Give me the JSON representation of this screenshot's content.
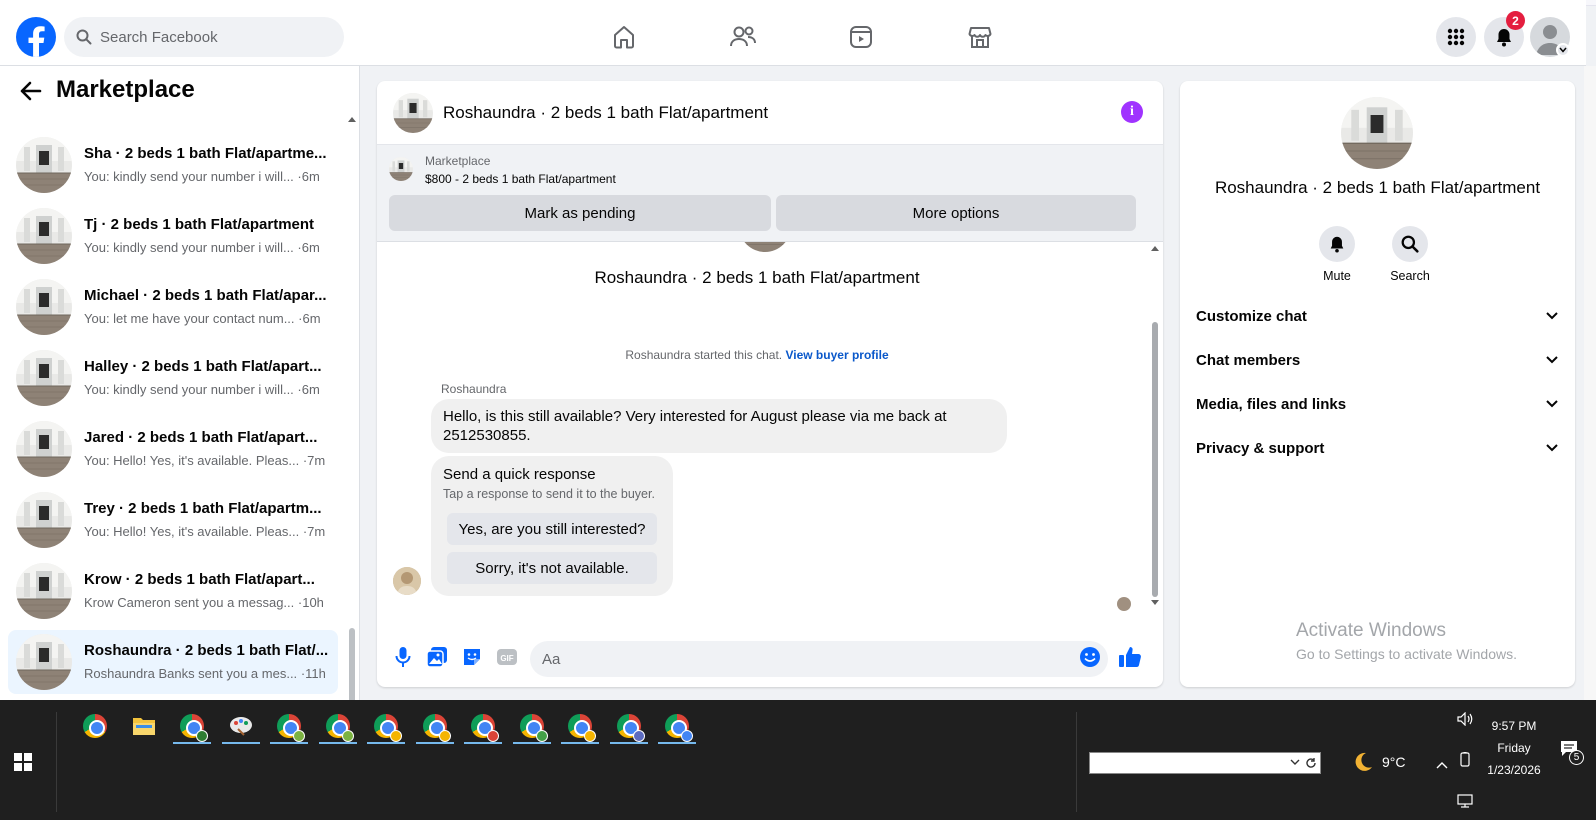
{
  "colors": {
    "fb_blue": "#0866ff",
    "badge_red": "#e41e3f",
    "info_purple": "#a033ff",
    "active_row": "#ebf5ff",
    "link_blue": "#0a58ca"
  },
  "topbar": {
    "search_placeholder": "Search Facebook",
    "notifications_count": "2",
    "nav_icons": [
      "home-icon",
      "friends-icon",
      "video-icon",
      "marketplace-icon"
    ],
    "right_icons": [
      "menu-grid-icon",
      "bell-icon",
      "profile-avatar"
    ]
  },
  "sidebar": {
    "title": "Marketplace",
    "conversations": [
      {
        "name": "Sha · 2 beds 1 bath Flat/apartme...",
        "preview": "You: kindly send your number i will...",
        "time": "·6m"
      },
      {
        "name": "Tj · 2 beds 1 bath Flat/apartment",
        "preview": "You: kindly send your number i will...",
        "time": "·6m"
      },
      {
        "name": "Michael · 2 beds 1 bath Flat/apar...",
        "preview": "You: let me have your contact num...",
        "time": "·6m"
      },
      {
        "name": "Halley · 2 beds 1 bath Flat/apart...",
        "preview": "You: kindly send your number i will...",
        "time": "·6m"
      },
      {
        "name": "Jared · 2 beds 1 bath Flat/apart...",
        "preview": "You: Hello! Yes, it's available. Pleas...",
        "time": "·7m"
      },
      {
        "name": "Trey · 2 beds 1 bath Flat/apartm...",
        "preview": "You: Hello! Yes, it's available. Pleas...",
        "time": "·7m"
      },
      {
        "name": "Krow · 2 beds 1 bath Flat/apart...",
        "preview": "Krow Cameron sent you a messag...",
        "time": "·10h"
      },
      {
        "name": "Roshaundra · 2 beds 1 bath Flat/...",
        "preview": "Roshaundra Banks sent you a mes...",
        "time": "·11h"
      }
    ]
  },
  "chat": {
    "header_title": "Roshaundra · 2 beds 1 bath Flat/apartment",
    "marketplace_label": "Marketplace",
    "listing": "$800 - 2 beds 1 bath Flat/apartment",
    "mark_pending": "Mark as pending",
    "more_options": "More options",
    "thread_title": "Roshaundra · 2 beds 1 bath Flat/apartment",
    "started_text": "Roshaundra started this chat.",
    "view_profile": "View buyer profile",
    "sender": "Roshaundra",
    "message": "Hello, is this still available? Very interested for August please via me back at 2512530855.",
    "quick_title": "Send a quick response",
    "quick_sub": "Tap a response to send it to the buyer.",
    "quick_1": "Yes, are you still interested?",
    "quick_2": "Sorry, it's not available.",
    "composer_placeholder": "Aa"
  },
  "details": {
    "title": "Roshaundra · 2 beds 1 bath Flat/apartment",
    "mute": "Mute",
    "search": "Search",
    "sections": [
      "Customize chat",
      "Chat members",
      "Media, files and links",
      "Privacy & support"
    ]
  },
  "watermark": {
    "line1": "Activate Windows",
    "line2": "Go to Settings to activate Windows."
  },
  "taskbar": {
    "weather": "9°C",
    "time": "9:57 PM",
    "day": "Friday",
    "date": "1/23/2026",
    "notification_count": "5"
  }
}
